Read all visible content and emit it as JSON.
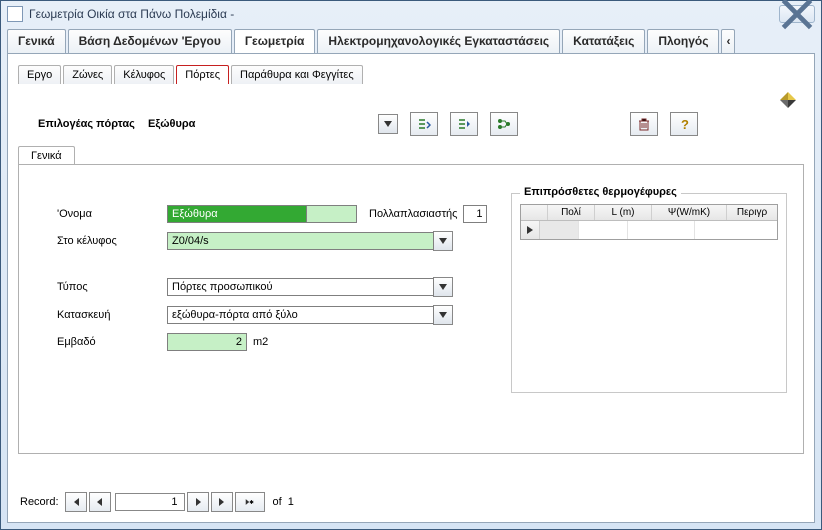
{
  "window": {
    "title": "Γεωμετρία Οικία στα Πάνω Πολεμίδια -"
  },
  "mainTabs": {
    "t1": "Γενικά",
    "t2": "Βάση Δεδομένων 'Εργου",
    "t3": "Γεωμετρία",
    "t4": "Ηλεκτρομηχανολογικές Εγκαταστάσεις",
    "t5": "Κατατάξεις",
    "t6": "Πλοηγός",
    "arrow": "‹"
  },
  "subTabs": {
    "s1": "Εργο",
    "s2": "Ζώνες",
    "s3": "Κέλυφος",
    "s4": "Πόρτες",
    "s5": "Παράθυρα και Φεγγίτες"
  },
  "selector": {
    "label": "Επιλογέας πόρτας",
    "value": "Εξώθυρα"
  },
  "innerTab": "Γενικά",
  "form": {
    "name_lbl": "'Ονομα",
    "name_val": "Εξώθυρα",
    "mult_lbl": "Πολλαπλασιαστής",
    "mult_val": "1",
    "shell_lbl": "Στο κέλυφος",
    "shell_val": "Z0/04/s",
    "type_lbl": "Τύπος",
    "type_val": "Πόρτες προσωπικού",
    "constr_lbl": "Κατασκευή",
    "constr_val": "εξώθυρα-πόρτα από ξύλο",
    "area_lbl": "Εμβαδό",
    "area_val": "2",
    "area_unit": "m2"
  },
  "bridges": {
    "title": "Επιπρόσθετες θερμογέφυρες",
    "cols": {
      "c1": "Πολί",
      "c2": "L (m)",
      "c3": "Ψ(W/mK)",
      "c4": "Περιγρ"
    }
  },
  "record": {
    "label": "Record:",
    "current": "1",
    "of": "of",
    "total": "1"
  }
}
